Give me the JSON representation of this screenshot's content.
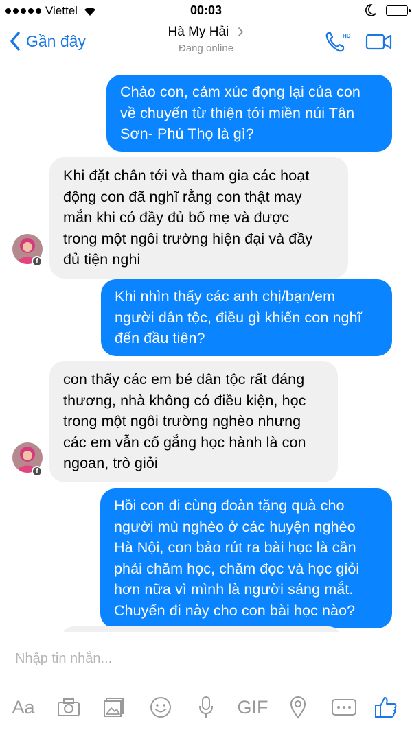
{
  "status_bar": {
    "carrier": "Viettel",
    "time": "00:03"
  },
  "nav": {
    "back_label": "Gần đây",
    "title": "Hà My Hải",
    "subtitle": "Đang online",
    "call_badge": "HD"
  },
  "messages": [
    {
      "direction": "outgoing",
      "lines": [
        "Chào con, cảm xúc đọng lại của con",
        "về chuyến từ thiện tới miền núi Tân",
        "Sơn- Phú Thọ là gì?"
      ]
    },
    {
      "direction": "incoming",
      "lines": [
        "Khi đặt chân tới và tham gia các hoạt",
        "động con đã nghĩ rằng con thật may",
        "mắn khi có đầy đủ bố mẹ và được",
        "trong một ngôi trường hiện đại và đầy",
        "đủ tiện nghi"
      ]
    },
    {
      "direction": "outgoing",
      "lines": [
        "Khi nhìn thấy các anh chị/bạn/em",
        "người dân tộc, điều gì khiến con nghĩ",
        "đến đầu tiên?"
      ]
    },
    {
      "direction": "incoming",
      "lines": [
        "con thấy các em bé dân tộc rất đáng",
        "thương, nhà không có điều kiện, học",
        "trong một ngôi trường nghèo nhưng",
        "các em vẫn cố gắng học hành là con",
        "ngoan, trò giỏi"
      ]
    },
    {
      "direction": "outgoing",
      "lines": [
        "Hồi con đi cùng đoàn tặng quà cho",
        "người mù nghèo ở các huyện nghèo",
        "Hà Nội, con bảo rút ra bài học là cần",
        "phải chăm học, chăm đọc và học giỏi",
        "hơn nữa vì mình là người sáng mắt.",
        "Chuyến đi này cho con bài học nào?"
      ]
    }
  ],
  "composer": {
    "placeholder": "Nhập tin nhắn...",
    "text_tool": "Aa",
    "gif_tool": "GIF"
  },
  "colors": {
    "accent": "#1a78e6",
    "outgoing_bubble": "#0a84ff",
    "incoming_bubble": "#f1f0f0",
    "toolbar_icon": "#9a9a9a"
  }
}
